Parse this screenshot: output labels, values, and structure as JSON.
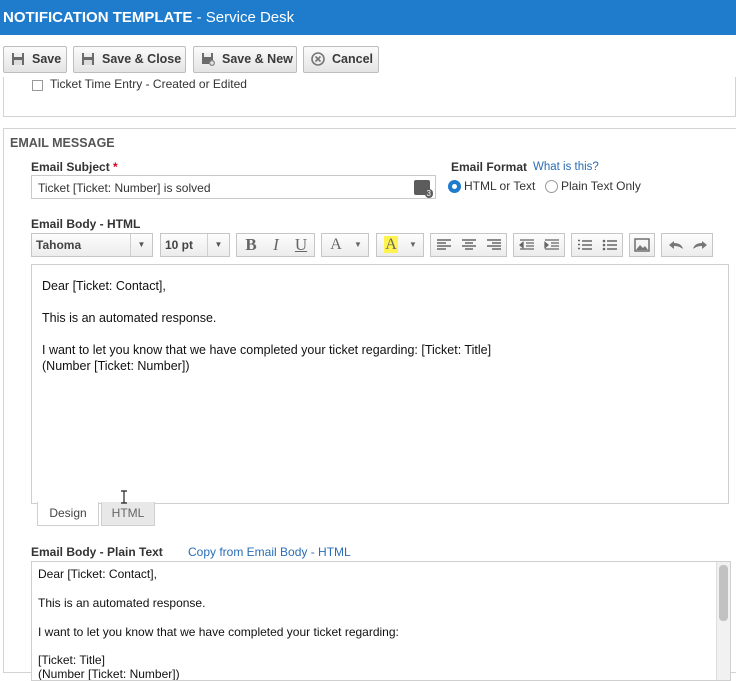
{
  "window": {
    "title_bold": "Notification Template",
    "title_rest": " - Service Desk"
  },
  "toolbar": {
    "save_label": "Save",
    "save_close_label": "Save & Close",
    "save_new_label": "Save & New",
    "cancel_label": "Cancel"
  },
  "previous": {
    "event_label": "Ticket Time Entry - Created or Edited",
    "event_checked": false
  },
  "email_message": {
    "section_title": "EMAIL MESSAGE",
    "subject_label": "Email Subject",
    "required_mark": "*",
    "subject_value": "Ticket [Ticket: Number] is solved",
    "format_label": "Email Format",
    "what_is_this": "What is this?",
    "format_options": [
      "HTML or Text",
      "Plain Text Only"
    ],
    "format_selected": "HTML or Text",
    "body_html_label": "Email Body - HTML",
    "font_name": "Tahoma",
    "font_size": "10 pt",
    "body_html_lines": [
      "Dear [Ticket: Contact],",
      "This is an automated response.",
      "I want to let you know that we have completed your ticket regarding: [Ticket: Title]",
      "(Number [Ticket: Number])"
    ],
    "tabs": [
      "Design",
      "HTML"
    ],
    "active_tab": "Design",
    "body_plain_label": "Email Body - Plain Text",
    "copy_link": "Copy from Email Body - HTML",
    "body_plain_lines": [
      "Dear [Ticket: Contact],",
      "This is an automated response.",
      "I want to let you know that we have completed your ticket regarding:",
      "[Ticket: Title]",
      "(Number [Ticket: Number])"
    ]
  },
  "colors": {
    "titlebar": "#1f7ccc",
    "link": "#2a6db5",
    "required": "#d0021b"
  },
  "icons": {
    "editor": [
      "bold-icon",
      "italic-icon",
      "underline-icon",
      "font-color-icon",
      "highlight-icon",
      "align-left-icon",
      "align-center-icon",
      "align-right-icon",
      "outdent-icon",
      "indent-icon",
      "bullet-list-icon",
      "number-list-icon",
      "image-icon",
      "undo-icon",
      "redo-icon"
    ]
  }
}
